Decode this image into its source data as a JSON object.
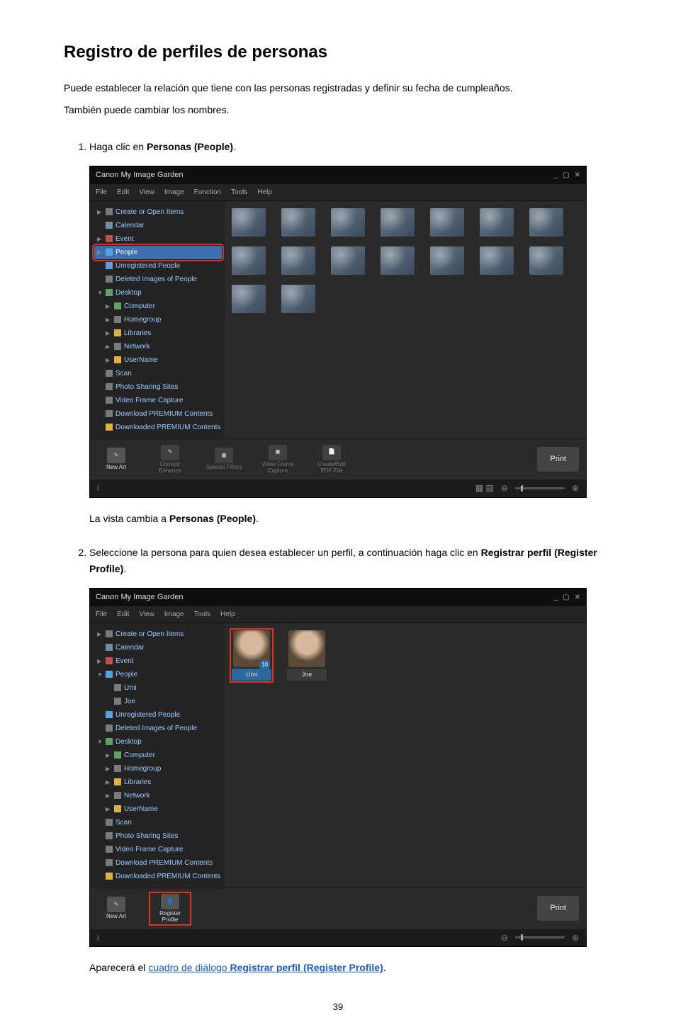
{
  "doc": {
    "title": "Registro de perfiles de personas",
    "intro1": "Puede establecer la relación que tiene con las personas registradas y definir su fecha de cumpleaños.",
    "intro2": "También puede cambiar los nombres.",
    "page_number": "39"
  },
  "step1": {
    "prefix": "Haga clic en ",
    "bold": "Personas (People)",
    "caption_prefix": "La vista cambia a ",
    "caption_bold": "Personas (People)"
  },
  "step2": {
    "prefix": "Seleccione la persona para quien desea establecer un perfil, a continuación haga clic en",
    "bold": "Registrar perfil (Register Profile)",
    "caption_prefix": "Aparecerá el ",
    "link_prefix": "cuadro de diálogo ",
    "link_bold": "Registrar perfil (Register Profile)"
  },
  "app": {
    "title": "Canon My Image Garden",
    "menu": [
      "File",
      "Edit",
      "View",
      "Image",
      "Function",
      "Tools",
      "Help"
    ],
    "menu_short": [
      "File",
      "Edit",
      "View",
      "Image",
      "Tools",
      "Help"
    ],
    "sidebar1": {
      "create_open": "Create or Open Items",
      "calendar": "Calendar",
      "event": "Event",
      "people": "People",
      "unreg": "Unregistered People",
      "deleted": "Deleted Images of People",
      "desktop": "Desktop",
      "computer": "Computer",
      "homegroup": "Homegroup",
      "libraries": "Libraries",
      "network": "Network",
      "username": "UserName",
      "scan": "Scan",
      "photoshare": "Photo Sharing Sites",
      "videoframe": "Video Frame Capture",
      "dlpremium": "Download PREMIUM Contents",
      "dledpremium": "Downloaded PREMIUM Contents"
    },
    "sidebar2": {
      "umi": "Umi",
      "joe": "Joe"
    },
    "people": {
      "umi": {
        "name": "Umi",
        "badge": "10"
      },
      "joe": {
        "name": "Joe"
      }
    },
    "toolbar": {
      "new_art": "New Art",
      "correct": "Correct/\nEnhance",
      "special": "Special\nFilters",
      "videoframe": "Video Frame\nCapture",
      "createpdf": "Create/Edit\nPDF File",
      "register_profile": "Register\nProfile",
      "print": "Print"
    },
    "status": {
      "info": "i",
      "plus": "⊕",
      "minus": "⊖"
    }
  }
}
